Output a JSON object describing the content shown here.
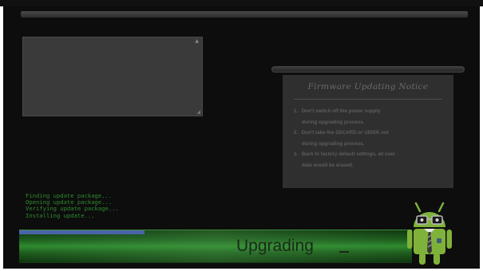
{
  "window": {
    "title": ""
  },
  "notice": {
    "title": "Firmware Updating Notice",
    "items": [
      {
        "num": "1.",
        "line1": "Don't switch off the power supply",
        "line2": "during upgrading  process."
      },
      {
        "num": "2.",
        "line1": "Don't take the SDCARD or UDISK out",
        "line2": "during upgrading  process."
      },
      {
        "num": "3.",
        "line1": "Back to factory default settings, all user",
        "line2": "data would be erased."
      }
    ]
  },
  "console": {
    "lines": [
      "Finding update package...",
      "Opening update package...",
      "Verifying update package...",
      "Installing update..."
    ]
  },
  "status": {
    "label": "Upgrading",
    "progress": 0.32
  },
  "colors": {
    "background": "#0d0d0d",
    "console_text": "#2e8a2e",
    "progress_fill": "#4a63a8",
    "bar_green": "#2e8a2e",
    "android_green": "#7fb23a"
  },
  "icons": {
    "mascot": "android-robot-icon"
  }
}
